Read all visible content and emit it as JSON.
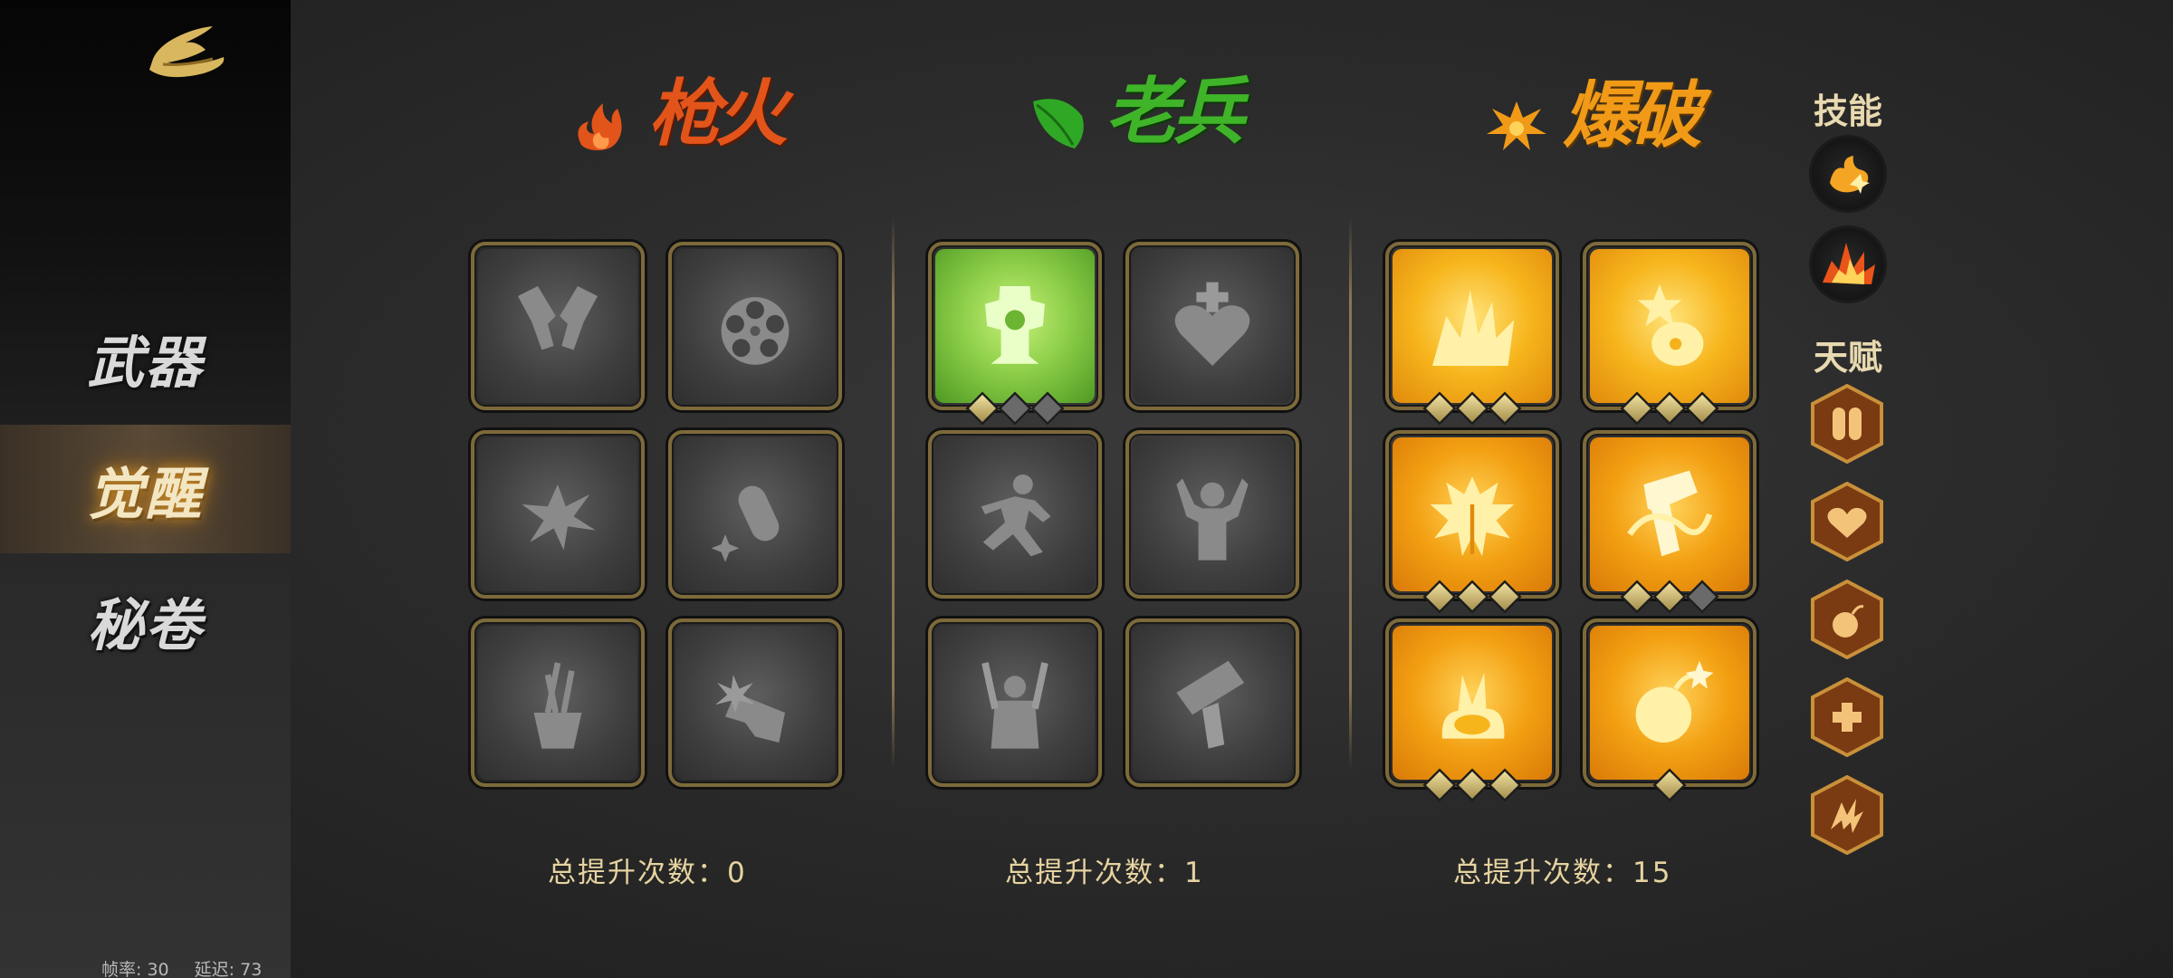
{
  "nav": {
    "items": [
      {
        "label": "武器",
        "active": false
      },
      {
        "label": "觉醒",
        "active": true
      },
      {
        "label": "秘卷",
        "active": false
      }
    ]
  },
  "status": {
    "fps": "帧率: 30",
    "latency": "延迟: 73"
  },
  "classes": [
    {
      "name": "枪火",
      "color": "#e3541a",
      "icon": "flame-icon",
      "total_label": "总提升次数：0"
    },
    {
      "name": "老兵",
      "color": "#3fb429",
      "icon": "leaf-icon",
      "total_label": "总提升次数：1"
    },
    {
      "name": "爆破",
      "color": "#f09a18",
      "icon": "explosion-icon",
      "total_label": "总提升次数：15"
    }
  ],
  "cards": {
    "gunfire": [
      {
        "icon": "dual-pistols-icon",
        "state": "locked"
      },
      {
        "icon": "revolver-cylinder-icon",
        "state": "locked"
      },
      {
        "icon": "bullet-burst-icon",
        "state": "locked"
      },
      {
        "icon": "bullet-sparkle-icon",
        "state": "locked"
      },
      {
        "icon": "quiver-arrows-icon",
        "state": "locked"
      },
      {
        "icon": "shotgun-blast-icon",
        "state": "locked"
      }
    ],
    "veteran": [
      {
        "icon": "armor-figure-icon",
        "state": "unlocked",
        "pips": [
          true,
          false,
          false
        ]
      },
      {
        "icon": "heart-cross-icon",
        "state": "locked"
      },
      {
        "icon": "sprinting-soldier-icon",
        "state": "locked"
      },
      {
        "icon": "enraged-soldier-icon",
        "state": "locked"
      },
      {
        "icon": "blade-soldier-icon",
        "state": "locked"
      },
      {
        "icon": "rocket-launcher-icon",
        "state": "locked"
      }
    ],
    "demolition": [
      {
        "icon": "big-explosion-icon",
        "state": "unlocked",
        "pips": [
          true,
          true,
          true
        ]
      },
      {
        "icon": "grenade-star-icon",
        "state": "unlocked",
        "pips": [
          true,
          true,
          true
        ]
      },
      {
        "icon": "head-explosion-icon",
        "state": "unlocked",
        "pips": [
          true,
          true,
          true
        ]
      },
      {
        "icon": "detonator-gun-icon",
        "state": "unlocked",
        "pips": [
          true,
          true,
          false
        ]
      },
      {
        "icon": "ground-blast-icon",
        "state": "unlocked",
        "pips": [
          true,
          true,
          true
        ]
      },
      {
        "icon": "bomb-spark-icon",
        "state": "unlocked",
        "pips": [
          true
        ]
      }
    ]
  },
  "right_panel": {
    "skills_title": "技能",
    "skills": [
      "spark-burst-icon",
      "fire-explosion-icon"
    ],
    "talents_title": "天赋",
    "talents": [
      "bullets-icon",
      "heart-badge-icon",
      "bomb-icon",
      "medkit-icon",
      "lightning-icon"
    ]
  }
}
